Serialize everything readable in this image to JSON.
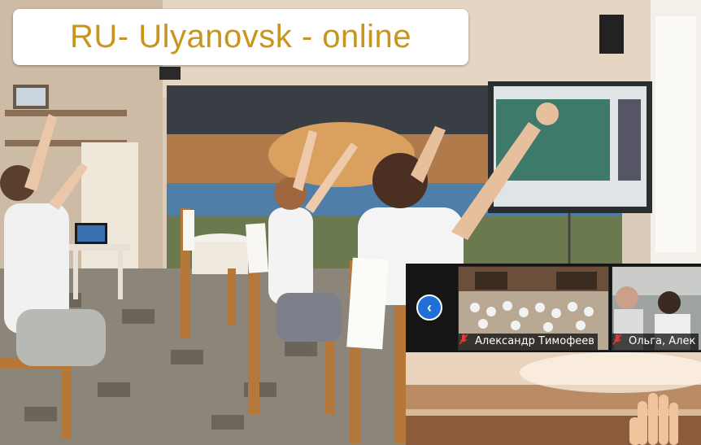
{
  "banner": {
    "title": "RU- Ulyanovsk - online",
    "color": "#c8961e"
  },
  "zoom": {
    "participants": [
      {
        "name": "Александр Тимофеев",
        "muted": true
      },
      {
        "name": "Ольга, Алек",
        "muted": true
      }
    ],
    "nav_icon": "chevron-left-icon",
    "mute_icon": "mic-muted-icon"
  }
}
